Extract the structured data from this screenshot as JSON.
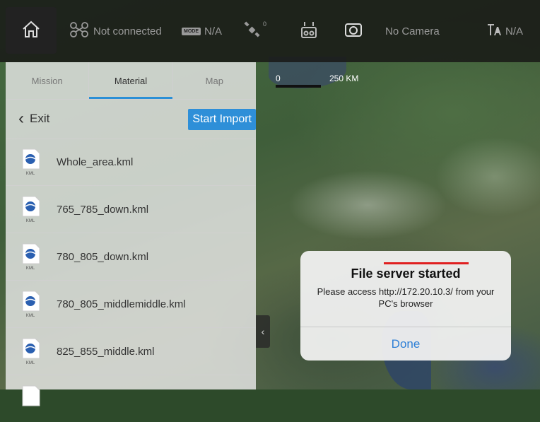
{
  "topbar": {
    "home_icon": "home-icon",
    "connection": {
      "icon": "drone-icon",
      "label": "Not connected"
    },
    "mode": {
      "badge": "MODE",
      "value": "N/A"
    },
    "gps": {
      "icon": "satellite-icon",
      "count": "0"
    },
    "remote": {
      "icon": "remote-controller-icon"
    },
    "camera": {
      "icon": "camera-icon",
      "label": "No Camera"
    },
    "battery": {
      "icon": "flight-mode-icon",
      "value": "N/A"
    }
  },
  "panel": {
    "tabs": [
      {
        "label": "Mission",
        "active": false
      },
      {
        "label": "Material",
        "active": true
      },
      {
        "label": "Map",
        "active": false
      }
    ],
    "exit_label": "Exit",
    "start_import_label": "Start Import",
    "files": [
      {
        "name": "Whole_area.kml",
        "badge": "KML"
      },
      {
        "name": "765_785_down.kml",
        "badge": "KML"
      },
      {
        "name": "780_805_down.kml",
        "badge": "KML"
      },
      {
        "name": "780_805_middlemiddle.kml",
        "badge": "KML"
      },
      {
        "name": "825_855_middle.kml",
        "badge": "KML"
      }
    ]
  },
  "map": {
    "scale_start": "0",
    "scale_end": "250 KM"
  },
  "dialog": {
    "title": "File server started",
    "message": "Please access http://172.20.10.3/ from your PC's browser",
    "button": "Done"
  },
  "colors": {
    "accent": "#2e8fd8",
    "dialog_button": "#2e7fd6",
    "highlight": "#e02020"
  }
}
